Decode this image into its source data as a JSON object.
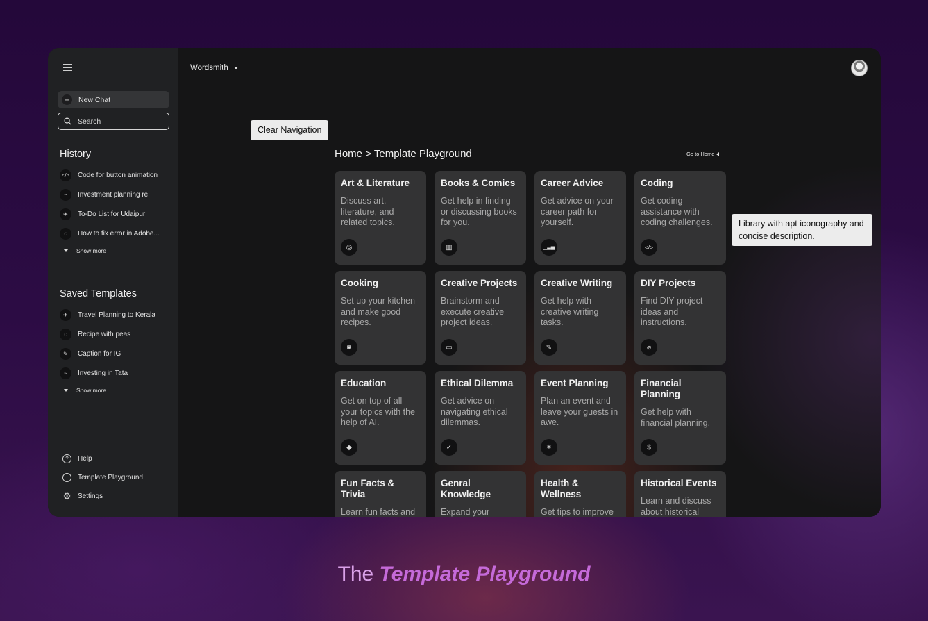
{
  "sidebar": {
    "new_chat": "New Chat",
    "search_placeholder": "Search",
    "history_title": "History",
    "history": [
      {
        "label": "Code for button animation",
        "icon": "code-icon",
        "glyph": "</>"
      },
      {
        "label": "Investment planning re",
        "icon": "chart-icon",
        "glyph": "~"
      },
      {
        "label": "To-Do List for Udaipur",
        "icon": "plane-icon",
        "glyph": "✈"
      },
      {
        "label": "How to fix error in Adobe...",
        "icon": "bulb-icon",
        "glyph": "◌"
      }
    ],
    "show_more": "Show more",
    "templates_title": "Saved Templates",
    "templates": [
      {
        "label": "Travel Planning to Kerala",
        "icon": "plane-icon",
        "glyph": "✈"
      },
      {
        "label": "Recipe with peas",
        "icon": "bulb-icon",
        "glyph": "◌"
      },
      {
        "label": "Caption for IG",
        "icon": "pencil-icon",
        "glyph": "✎"
      },
      {
        "label": "Investing in Tata",
        "icon": "chart-icon",
        "glyph": "~"
      }
    ],
    "show_more_2": "Show more",
    "bottom": [
      {
        "label": "Help",
        "icon": "help-icon",
        "glyph": "?"
      },
      {
        "label": "Template Playground",
        "icon": "info-icon",
        "glyph": "i"
      },
      {
        "label": "Settings",
        "icon": "gear-icon",
        "glyph": "⚙"
      }
    ]
  },
  "header": {
    "model": "Wordsmith"
  },
  "callouts": {
    "navigation": "Clear Navigation",
    "library": "Library with apt iconography and concise description."
  },
  "breadcrumb": {
    "home": "Home",
    "separator": ">",
    "current": "Template Playground",
    "goto_home": "Go to Home"
  },
  "cards": [
    {
      "title": "Art & Literature",
      "desc": "Discuss art, literature, and related topics.",
      "icon": "palette-icon",
      "glyph": "◎"
    },
    {
      "title": "Books & Comics",
      "desc": "Get help in finding or discussing books for you.",
      "icon": "books-icon",
      "glyph": "▥"
    },
    {
      "title": "Career Advice",
      "desc": "Get advice on your career path for yourself.",
      "icon": "bar-chart-icon",
      "glyph": "▁▃▅"
    },
    {
      "title": "Coding",
      "desc": "Get coding assistance with coding challenges.",
      "icon": "code-icon",
      "glyph": "</>"
    },
    {
      "title": "Cooking",
      "desc": "Set up your kitchen and make good recipes.",
      "icon": "pot-icon",
      "glyph": "◙"
    },
    {
      "title": "Creative Projects",
      "desc": "Brainstorm and execute creative project ideas.",
      "icon": "folder-icon",
      "glyph": "▭"
    },
    {
      "title": "Creative Writing",
      "desc": "Get help with creative writing tasks.",
      "icon": "pencil-icon",
      "glyph": "✎"
    },
    {
      "title": "DIY Projects",
      "desc": "Find DIY project ideas and instructions.",
      "icon": "paperclip-icon",
      "glyph": "⌀"
    },
    {
      "title": "Education",
      "desc": "Get on top of all your topics with the help of AI.",
      "icon": "graduation-cap-icon",
      "glyph": "◆"
    },
    {
      "title": "Ethical Dilemma",
      "desc": "Get advice on navigating ethical dilemmas.",
      "icon": "shield-icon",
      "glyph": "✓"
    },
    {
      "title": "Event Planning",
      "desc": "Plan an event and leave your guests in awe.",
      "icon": "party-icon",
      "glyph": "✶"
    },
    {
      "title": "Financial Planning",
      "desc": "Get help with financial planning.",
      "icon": "money-icon",
      "glyph": "$"
    },
    {
      "title": "Fun Facts & Trivia",
      "desc": "Learn fun facts and",
      "icon": "",
      "glyph": ""
    },
    {
      "title": "Genral Knowledge",
      "desc": "Expand your",
      "icon": "",
      "glyph": ""
    },
    {
      "title": "Health & Wellness",
      "desc": "Get tips to improve",
      "icon": "",
      "glyph": ""
    },
    {
      "title": "Historical Events",
      "desc": "Learn and discuss about historical",
      "icon": "",
      "glyph": ""
    }
  ],
  "caption": {
    "prefix": "The",
    "emphasis": "Template Playground"
  }
}
